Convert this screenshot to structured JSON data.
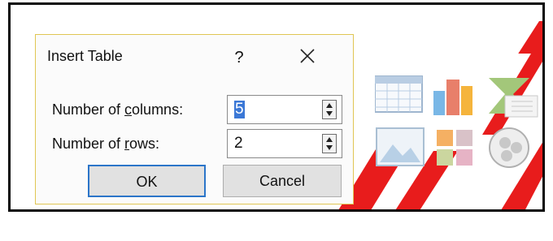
{
  "dialog": {
    "title": "Insert Table",
    "help_label": "?",
    "close_icon": "close-icon",
    "columns_label_pre": "Number of ",
    "columns_label_mnemonic": "c",
    "columns_label_post": "olumns:",
    "columns_value": "5",
    "rows_label_pre": "Number of ",
    "rows_label_mnemonic": "r",
    "rows_label_post": "ows:",
    "rows_value": "2",
    "ok_label": "OK",
    "cancel_label": "Cancel"
  },
  "placeholder_icons": [
    "table-icon",
    "chart-icon",
    "smartart-icon",
    "picture-icon",
    "online-pictures-icon",
    "video-icon"
  ],
  "colors": {
    "dialog_border": "#e0c653",
    "ok_border": "#2b75c9",
    "watermark": "#e81c1c"
  }
}
